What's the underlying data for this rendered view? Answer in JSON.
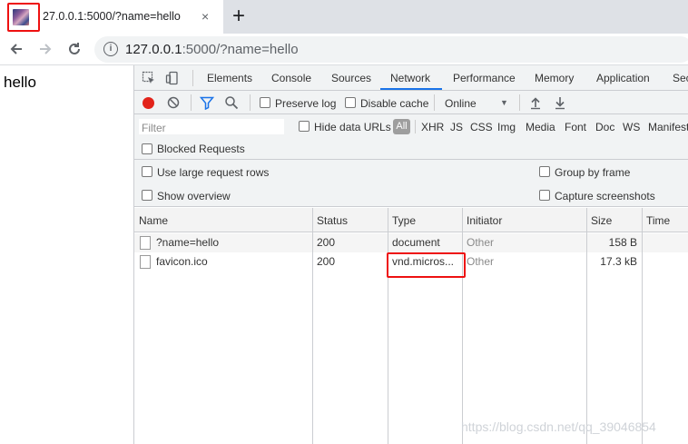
{
  "browser": {
    "tab_title": "27.0.0.1:5000/?name=hello",
    "tab_close": "×",
    "new_tab": "+",
    "url_host": "127.0.0.1",
    "url_rest": ":5000/?name=hello"
  },
  "page": {
    "text": "hello"
  },
  "devtools": {
    "tabs": [
      "Elements",
      "Console",
      "Sources",
      "Network",
      "Performance",
      "Memory",
      "Application",
      "Sec"
    ],
    "active_tab": "Network",
    "toolbar": {
      "preserve_log": "Preserve log",
      "disable_cache": "Disable cache",
      "throttle": "Online",
      "throttle_arrow": "▼"
    },
    "filter": {
      "placeholder": "Filter",
      "hide_data_urls": "Hide data URLs",
      "all": "All",
      "types": [
        "XHR",
        "JS",
        "CSS",
        "Img",
        "Media",
        "Font",
        "Doc",
        "WS",
        "Manifest"
      ]
    },
    "blocked_requests": "Blocked Requests",
    "options": {
      "large_rows": "Use large request rows",
      "overview": "Show overview",
      "group_by_frame": "Group by frame",
      "capture_screenshots": "Capture screenshots"
    },
    "columns": [
      "Name",
      "Status",
      "Type",
      "Initiator",
      "Size",
      "Time"
    ],
    "rows": [
      {
        "name": "?name=hello",
        "status": "200",
        "type": "document",
        "initiator": "Other",
        "size": "158 B"
      },
      {
        "name": "favicon.ico",
        "status": "200",
        "type": "vnd.micros...",
        "initiator": "Other",
        "size": "17.3 kB"
      }
    ]
  },
  "watermark": "https://blog.csdn.net/qq_39046854",
  "colors": {
    "highlight": "#e11111",
    "record": "#e2231a",
    "active_tab_underline": "#1a73e8"
  }
}
